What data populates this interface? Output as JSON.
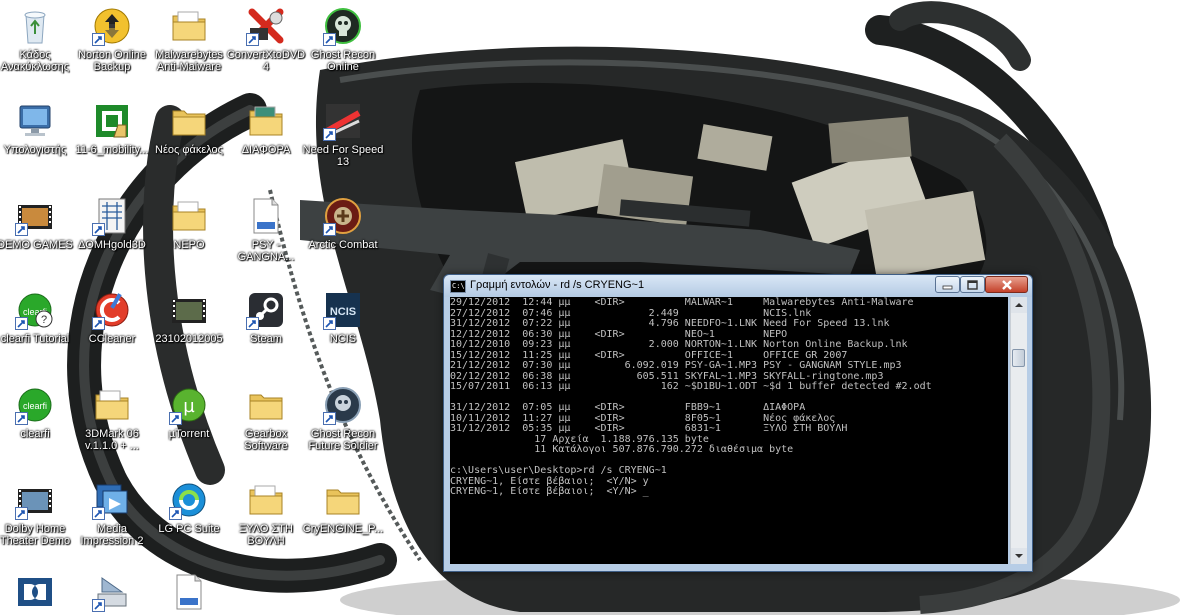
{
  "desktop": {
    "icons": [
      {
        "id": "recycle",
        "label": "Κάδος Ανακύκλωσης",
        "icon": "recycle-bin-icon"
      },
      {
        "id": "norton",
        "label": "Norton Online Backup",
        "icon": "norton-backup-icon"
      },
      {
        "id": "malwarebytes",
        "label": "Malwarebytes Anti-Malware",
        "icon": "folder-icon"
      },
      {
        "id": "convertxtodvd",
        "label": "ConvertXtoDVD 4",
        "icon": "convertxtodvd-icon"
      },
      {
        "id": "ghostrecon",
        "label": "Ghost Recon Online",
        "icon": "ghost-recon-icon"
      },
      {
        "id": "computer",
        "label": "Υπολογιστής",
        "icon": "computer-icon"
      },
      {
        "id": "mobility",
        "label": "11-6_mobility...",
        "icon": "installer-icon"
      },
      {
        "id": "newfolder",
        "label": "Νέος φάκελος",
        "icon": "folder-icon"
      },
      {
        "id": "diafora",
        "label": "ΔΙΑΦΟΡΑ",
        "icon": "folder-icon"
      },
      {
        "id": "nfs13",
        "label": "Need For Speed 13",
        "icon": "nfs-icon"
      },
      {
        "id": "demogames",
        "label": "DEMO GAMES",
        "icon": "video-icon"
      },
      {
        "id": "domh",
        "label": "ΔΟΜΗgold3D",
        "icon": "domh-icon"
      },
      {
        "id": "nepo",
        "label": "NEPO",
        "icon": "folder-icon"
      },
      {
        "id": "psy",
        "label": "PSY - GANGNA...",
        "icon": "mp3-icon"
      },
      {
        "id": "arctic",
        "label": "Arctic Combat",
        "icon": "arctic-combat-icon"
      },
      {
        "id": "clearfi_tut",
        "label": "clearfi Tutorial",
        "icon": "clearfi-help-icon"
      },
      {
        "id": "ccleaner",
        "label": "CCleaner",
        "icon": "ccleaner-icon"
      },
      {
        "id": "date2012",
        "label": "23102012005",
        "icon": "video-icon"
      },
      {
        "id": "steam",
        "label": "Steam",
        "icon": "steam-icon"
      },
      {
        "id": "ncis",
        "label": "NCIS",
        "icon": "ncis-icon"
      },
      {
        "id": "clearfi",
        "label": "clearfi",
        "icon": "clearfi-icon"
      },
      {
        "id": "3dmark",
        "label": "3DMark 06 v.1.1.0 + ...",
        "icon": "folder-icon"
      },
      {
        "id": "utorrent",
        "label": "µTorrent",
        "icon": "utorrent-icon"
      },
      {
        "id": "gearbox",
        "label": "Gearbox Software",
        "icon": "folder-icon"
      },
      {
        "id": "grfs",
        "label": "Ghost Recon Future Soldier",
        "icon": "ghost-recon-fs-icon"
      },
      {
        "id": "dolbydemo",
        "label": "Dolby Home Theater Demo",
        "icon": "video-icon"
      },
      {
        "id": "mediaimp",
        "label": "Media Impression 2",
        "icon": "media-impression-icon"
      },
      {
        "id": "lgpc",
        "label": "LG PC Suite",
        "icon": "lg-pc-suite-icon"
      },
      {
        "id": "xylo",
        "label": "ΞΥΛΟ ΣΤΗ ΒΟΥΛΗ",
        "icon": "folder-icon"
      },
      {
        "id": "cryengine",
        "label": "CryENGINE_P...",
        "icon": "folder-icon"
      },
      {
        "id": "dolby",
        "label": "",
        "icon": "dolby-icon"
      },
      {
        "id": "scanner",
        "label": "",
        "icon": "scanner-icon"
      },
      {
        "id": "mp3b",
        "label": "",
        "icon": "mp3-icon"
      }
    ]
  },
  "cmd_window": {
    "title": "Γραμμή εντολών - rd  /s CRYENG~1",
    "icon_label": "C:\\",
    "lines": [
      "29/12/2012  12:44 μμ    <DIR>          MALWAR~1     Malwarebytes Anti-Malware",
      "27/12/2012  07:46 μμ             2.449              NCIS.lnk",
      "31/12/2012  07:22 μμ             4.796 NEEDFO~1.LNK Need For Speed 13.lnk",
      "12/12/2012  06:30 μμ    <DIR>          NEO~1        NEPO",
      "10/12/2010  09:23 μμ             2.000 NORTON~1.LNK Norton Online Backup.lnk",
      "15/12/2012  11:25 μμ    <DIR>          OFFICE~1     OFFICE GR 2007",
      "21/12/2012  07:30 μμ         6.092.019 PSY-GA~1.MP3 PSY - GANGNAM STYLE.mp3",
      "02/12/2012  06:38 μμ           605.511 SKYFAL~1.MP3 SKYFALL-ringtone.mp3",
      "15/07/2011  06:13 μμ               162 ~$D1BU~1.ODT ~$d 1 buffer detected #2.odt",
      "",
      "31/12/2012  07:05 μμ    <DIR>          FBB9~1       ΔΙΑΦΟΡΑ",
      "10/11/2012  11:27 μμ    <DIR>          8F05~1       Νέος φάκελος",
      "31/12/2012  05:35 μμ    <DIR>          6831~1       ΞΥΛΟ ΣΤΗ ΒΟΥΛΗ",
      "              17 Αρχεία  1.188.976.135 byte",
      "              11 Κατάλογοι 507.876.790.272 διαθέσιμα byte",
      "",
      "c:\\Users\\user\\Desktop>rd /s CRYENG~1",
      "CRYENG~1, Είστε βέβαιοι;  <Y/N> y",
      "CRYENG~1, Είστε βέβαιοι;  <Y/N> _"
    ]
  }
}
